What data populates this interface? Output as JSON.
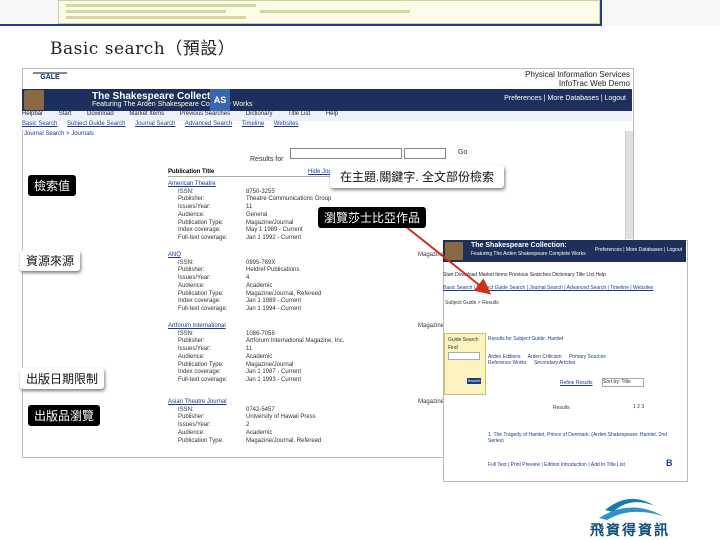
{
  "slide": {
    "title": "Basic search（預設）",
    "callouts": {
      "search_term": "檢索值",
      "source": "資源來源",
      "date_limit": "出版日期限制",
      "publication_browse": "出版品瀏覽",
      "field_search": "在主題.關鍵字. 全文部份檢索",
      "browse_shakespeare": "瀏覽莎士比亞作品"
    },
    "footer_logo_text": "飛資得資訊"
  },
  "browser": {
    "vendor_logo": "GALE",
    "provider_lines": [
      "Physical Information Services",
      "InfoTrac Web Demo"
    ],
    "banner": {
      "title": "The Shakespeare Collection:",
      "subtitle": "Featuring The Arden Shakespeare Complete Works",
      "badge": "AS",
      "prefs": "Preferences | More Databases | Logout"
    },
    "toolbar": [
      "Helpbar",
      "Start",
      "Download",
      "Market Items",
      "Previous Searches",
      "Dictionary",
      "Title List",
      "Help"
    ],
    "nav": [
      "Basic Search",
      "Subject Guide Search",
      "Journal Search",
      "Advanced Search",
      "Timeline",
      "Websites"
    ],
    "breadcrumb": "Journal Search > Journals",
    "find": {
      "label": "Results for",
      "go": "Go"
    },
    "column_header": "Publication Title",
    "column_header_right": "Hide Journals",
    "publications": [
      {
        "name": "American Theatre",
        "rows": [
          [
            "ISSN:",
            "8750-3255"
          ],
          [
            "Publisher:",
            "Theatre Communications Group"
          ],
          [
            "Issues/Year:",
            "11"
          ],
          [
            "Audience:",
            "General"
          ],
          [
            "Publication Type:",
            "Magazine/Journal"
          ],
          [
            "Index coverage:",
            "May 1 1989 - Current"
          ],
          [
            "Full-text coverage:",
            "Jan 1 1992 - Current"
          ]
        ]
      },
      {
        "name": "ANQ",
        "rows": [
          [
            "ISSN:",
            "0895-769X"
          ],
          [
            "Publisher:",
            "Heldref Publications"
          ],
          [
            "Issues/Year:",
            "4"
          ],
          [
            "Audience:",
            "Academic"
          ],
          [
            "Publication Type:",
            "Magazine/Journal, Refereed"
          ],
          [
            "Index coverage:",
            "Jan 1 1989 - Current"
          ],
          [
            "Full-text coverage:",
            "Jan 1 1994 - Current"
          ]
        ]
      },
      {
        "name": "Artforum International",
        "rows": [
          [
            "ISSN:",
            "1086-7058"
          ],
          [
            "Publisher:",
            "Artforum International Magazine, Inc."
          ],
          [
            "Issues/Year:",
            "11"
          ],
          [
            "Audience:",
            "Academic"
          ],
          [
            "Publication Type:",
            "Magazine/Journal"
          ],
          [
            "Index coverage:",
            "Jan 1 1987 - Current"
          ],
          [
            "Full-text coverage:",
            "Jan 1 1993 - Current"
          ]
        ]
      },
      {
        "name": "Asian Theatre Journal",
        "rows": [
          [
            "ISSN:",
            "0742-5457"
          ],
          [
            "Publisher:",
            "University of Hawaii Press"
          ],
          [
            "Issues/Year:",
            "2"
          ],
          [
            "Audience:",
            "Academic"
          ],
          [
            "Publication Type:",
            "Magazine/Journal, Refereed"
          ]
        ]
      }
    ],
    "magazine_tag": "Magazine"
  },
  "inset": {
    "banner_title": "The Shakespeare Collection:",
    "banner_subtitle": "Featuring The Arden Shakespeare Complete Works",
    "banner_prefs": "Preferences | More Databases | Logout",
    "toolbar": "Start  Download  Market Items  Previous Searches  Dictionary  Title List  Help",
    "nav": "Basic Search | Subject Guide Search | Journal Search | Advanced Search | Timeline | Websites",
    "breadcrumb": "Subject Guide > Results",
    "guide_title": "Guide Search",
    "guide_field": "Find",
    "guide_button": "Search",
    "heading": "Results for Subject Guide: Hamlet",
    "tabs": [
      "Arden Editions",
      "Arden Criticism",
      "Primary Sources",
      "Reference Works",
      "Secondary Articles"
    ],
    "link": "Refine Results",
    "sort": "Sort by: Title",
    "find_label": "Results",
    "pages": "1 2 3",
    "result": "1. The Tragedy of Hamlet, Prince of Denmark. (Arden Shakespeare: Hamlet, 2nd Series)",
    "result_links": "Full Text | Print Preview | Edition Introduction | Add to Title List",
    "bold_b": "B"
  },
  "colors": {
    "banner": "#1d2f5c",
    "link": "#1a3a8a",
    "arrow": "#d0301c",
    "logo": "#12507a"
  }
}
